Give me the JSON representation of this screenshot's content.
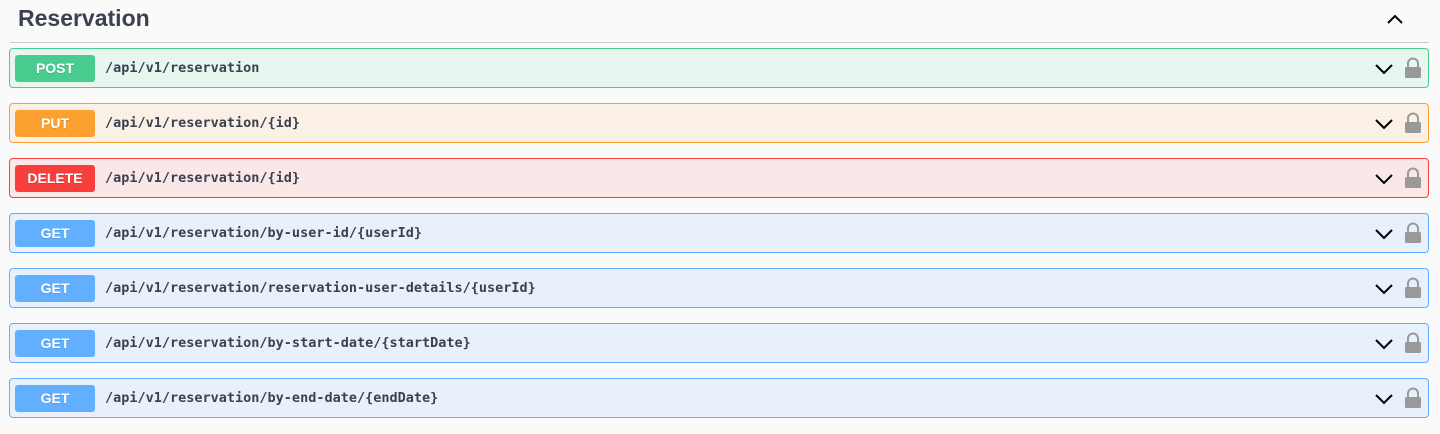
{
  "section": {
    "title": "Reservation"
  },
  "operations": [
    {
      "method": "POST",
      "path": "/api/v1/reservation"
    },
    {
      "method": "PUT",
      "path": "/api/v1/reservation/{id}"
    },
    {
      "method": "DELETE",
      "path": "/api/v1/reservation/{id}"
    },
    {
      "method": "GET",
      "path": "/api/v1/reservation/by-user-id/{userId}"
    },
    {
      "method": "GET",
      "path": "/api/v1/reservation/reservation-user-details/{userId}"
    },
    {
      "method": "GET",
      "path": "/api/v1/reservation/by-start-date/{startDate}"
    },
    {
      "method": "GET",
      "path": "/api/v1/reservation/by-end-date/{endDate}"
    }
  ],
  "icons": {
    "collapse": "chevron-up-icon",
    "expand": "chevron-down-icon",
    "lock": "lock-icon"
  },
  "colors": {
    "post": "#49cc90",
    "put": "#fca130",
    "delete": "#f93e3e",
    "get": "#61affe",
    "text": "#3b4151"
  }
}
